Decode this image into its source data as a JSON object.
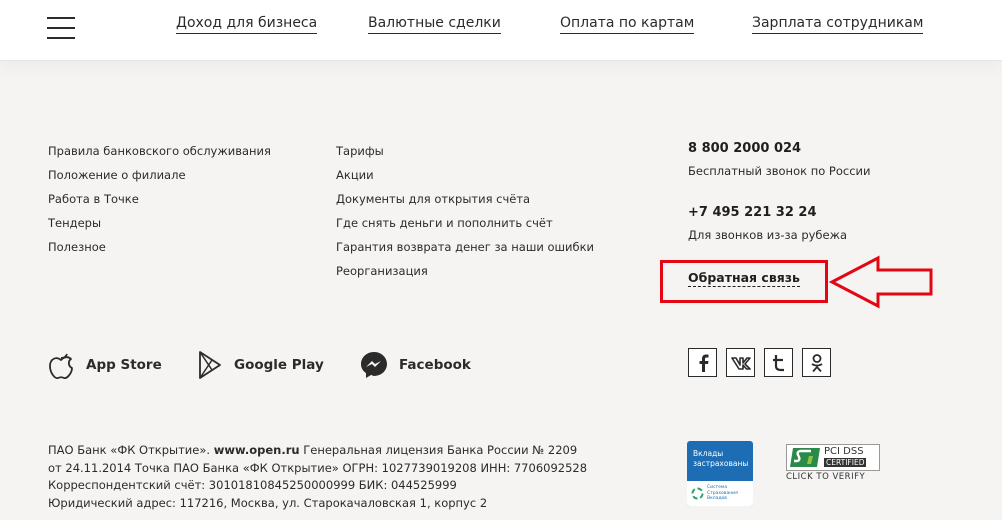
{
  "header": {
    "nav": [
      {
        "label": "Доход для бизнеса"
      },
      {
        "label": "Валютные сделки"
      },
      {
        "label": "Оплата по картам"
      },
      {
        "label": "Зарплата сотрудникам"
      }
    ]
  },
  "footer": {
    "col1": [
      "Правила банковского обслуживания",
      "Положение о филиале",
      "Работа в Точке",
      "Тендеры",
      "Полезное"
    ],
    "col2": [
      "Тарифы",
      "Акции",
      "Документы для открытия счёта",
      "Где снять деньги и пополнить счёт",
      "Гарантия возврата денег за наши ошибки",
      "Реорганизация"
    ],
    "contacts": {
      "phone1": "8 800 2000 024",
      "phone1_note": "Бесплатный звонок по России",
      "phone2": "+7 495 221 32 24",
      "phone2_note": "Для звонков из-за рубежа",
      "feedback": "Обратная связь"
    },
    "apps": [
      {
        "label": "App Store",
        "icon": "apple-icon"
      },
      {
        "label": "Google Play",
        "icon": "google-play-icon"
      },
      {
        "label": "Facebook",
        "icon": "messenger-icon"
      }
    ],
    "social": [
      "facebook-icon",
      "vk-icon",
      "twitter-icon",
      "odnoklassniki-icon"
    ],
    "legal": {
      "line1_pre": "ПАО Банк «ФК Открытие». ",
      "line1_link": "www.open.ru",
      "line1_post": " Генеральная лицензия Банка России № 2209",
      "line2": "от 24.11.2014 Точка ПАО Банка «ФК Открытие» ОГРН: 1027739019208 ИНН: 7706092528",
      "line3": "Корреспондентский счёт: 30101810845250000999 БИК: 044525999",
      "line4": "Юридический адрес: 117216, Москва, ул. Старокачаловская 1, корпус 2"
    },
    "badges": {
      "deposit_line1": "Вклады",
      "deposit_line2": "застрахованы",
      "deposit_small1": "Система",
      "deposit_small2": "Страхования",
      "deposit_small3": "Вкладов",
      "pci_line1": "PCI DSS",
      "pci_line2": "CERTIFIED",
      "pci_line3": "CLICK TO VERIFY"
    },
    "colors": {
      "highlight": "#e30613",
      "badge_blue": "#1d6db4"
    }
  }
}
